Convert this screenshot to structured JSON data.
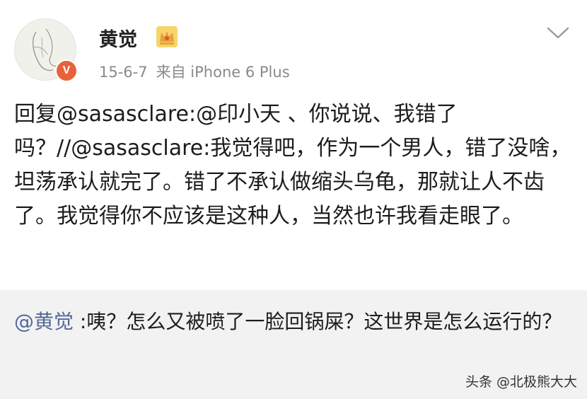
{
  "post": {
    "username": "黄觉",
    "date": "15-6-7",
    "source": "来自 iPhone 6 Plus",
    "verified_badge": "V",
    "crown_icon": "crown-icon",
    "text": "回复@sasasclare:@印小天 、你说说、我错了吗？//@sasasclare:我觉得吧，作为一个男人，错了没啥，坦荡承认就完了。错了不承认做缩头乌龟，那就让人不齿了。我觉得你不应该是这种人，当然也许我看走眼了。"
  },
  "repost": {
    "mention": "@黄觉",
    "text": " :咦？怎么又被喷了一脸回锅屎？这世界是怎么运行的？"
  },
  "watermark": "头条 @北极熊大大",
  "colors": {
    "badge": "#e8613a",
    "mention_link": "#53679a",
    "repost_bg": "#f2f2f2",
    "meta_text": "#8a8a8a"
  }
}
